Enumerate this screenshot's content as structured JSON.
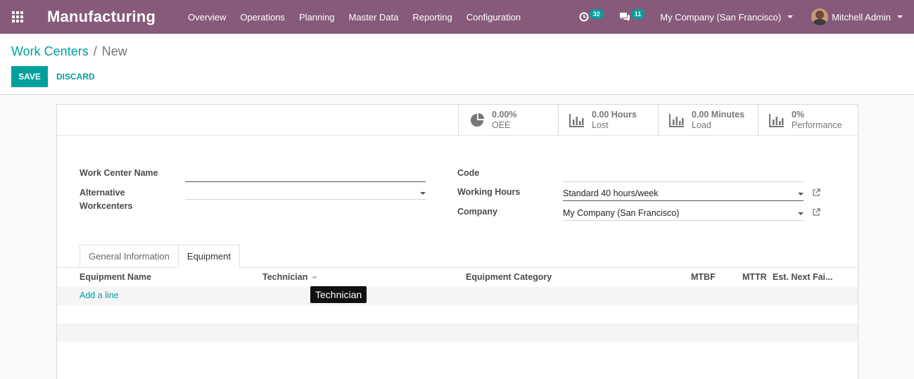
{
  "navbar": {
    "brand": "Manufacturing",
    "menu": [
      "Overview",
      "Operations",
      "Planning",
      "Master Data",
      "Reporting",
      "Configuration"
    ],
    "activities_count": "32",
    "messages_count": "11",
    "company": "My Company (San Francisco)",
    "user": "Mitchell Admin"
  },
  "breadcrumb": {
    "parent": "Work Centers",
    "separator": "/",
    "current": "New"
  },
  "actions": {
    "save": "SAVE",
    "discard": "DISCARD"
  },
  "stats": [
    {
      "value": "0.00%",
      "label": "OEE",
      "icon": "pie-chart-icon"
    },
    {
      "value": "0.00 Hours",
      "label": "Lost",
      "icon": "bar-chart-icon"
    },
    {
      "value": "0.00 Minutes",
      "label": "Load",
      "icon": "bar-chart-icon"
    },
    {
      "value": "0%",
      "label": "Performance",
      "icon": "bar-chart-icon"
    }
  ],
  "form": {
    "name_label": "Work Center Name",
    "name_value": "",
    "alt_label_1": "Alternative",
    "alt_label_2": "Workcenters",
    "alt_value": "",
    "code_label": "Code",
    "code_value": "",
    "hours_label": "Working Hours",
    "hours_value": "Standard 40 hours/week",
    "company_label": "Company",
    "company_value": "My Company (San Francisco)"
  },
  "tabs": [
    "General Information",
    "Equipment"
  ],
  "table": {
    "columns": [
      "Equipment Name",
      "Technician",
      "Equipment Category",
      "MTBF",
      "MTTR",
      "Est. Next Fai..."
    ],
    "add_line": "Add a line"
  },
  "tooltip": "Technician",
  "colors": {
    "primary": "#875a7b",
    "accent": "#00a09d"
  }
}
